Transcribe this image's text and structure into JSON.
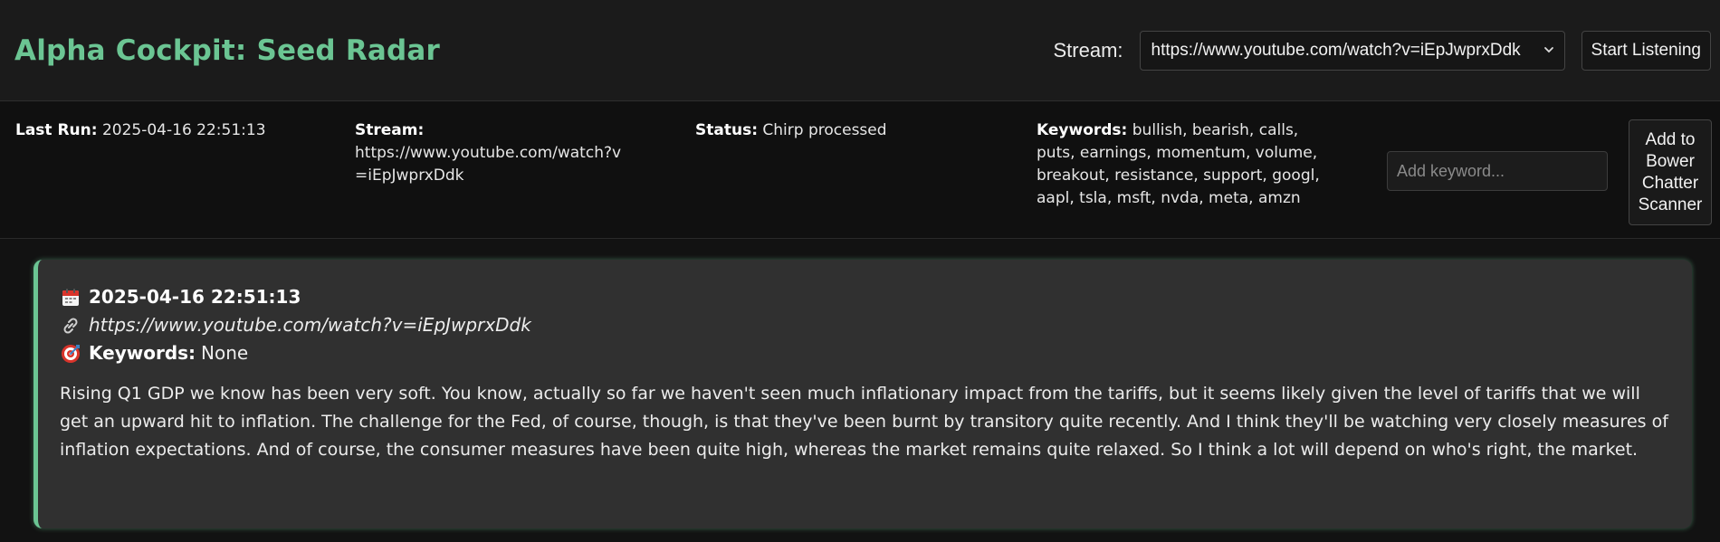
{
  "app": {
    "title": "Alpha Cockpit: Seed Radar"
  },
  "header": {
    "stream_label": "Stream:",
    "stream_selected": "https://www.youtube.com/watch?v=iEpJwprxDdk",
    "start_button": "Start Listening"
  },
  "status": {
    "last_run_label": "Last Run:",
    "last_run_value": "2025-04-16 22:51:13",
    "stream_label": "Stream:",
    "stream_value": "https://www.youtube.com/watch?v=iEpJwprxDdk",
    "status_label": "Status:",
    "status_value": "Chirp processed",
    "keywords_label": "Keywords:",
    "keywords_value": "bullish, bearish, calls, puts, earnings, momentum, volume, breakout, resistance, support, googl, aapl, tsla, msft, nvda, meta, amzn",
    "keyword_input_placeholder": "Add keyword...",
    "add_button": "Add to Bower Chatter Scanner"
  },
  "feed": {
    "cards": [
      {
        "timestamp": "2025-04-16 22:51:13",
        "url": "https://www.youtube.com/watch?v=iEpJwprxDdk",
        "keywords_label": "Keywords:",
        "keywords_value": "None",
        "transcript": "Rising Q1 GDP we know has been very soft. You know, actually so far we haven't seen much inflationary impact from the tariffs, but it seems likely given the level of tariffs that we will get an upward hit to inflation. The challenge for the Fed, of course, though, is that they've been burnt by transitory quite recently. And I think they'll be watching very closely measures of inflation expectations. And of course, the consumer measures have been quite high, whereas the market remains quite relaxed. So I think a lot will depend on who's right, the market."
      }
    ]
  },
  "icons": {
    "date": "calendar-icon",
    "url": "link-icon",
    "keywords": "target-icon"
  },
  "colors": {
    "accent": "#6bc593",
    "background": "#121212",
    "card": "#303030"
  }
}
